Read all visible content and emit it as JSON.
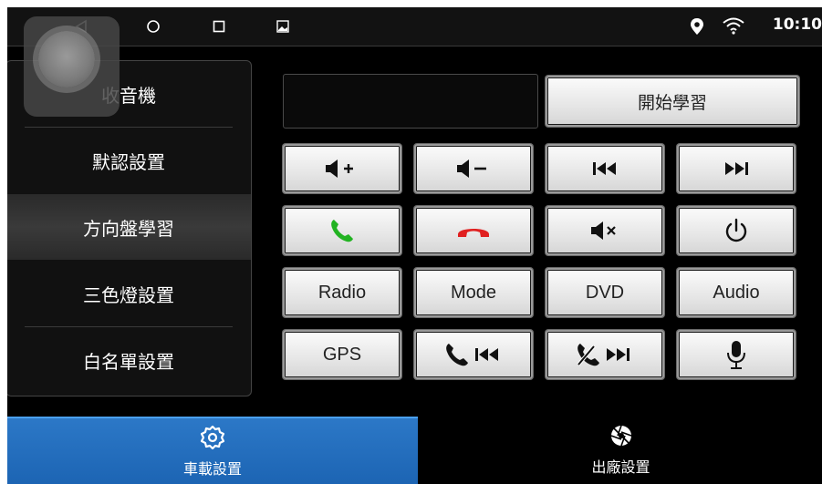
{
  "statusbar": {
    "time": "10:10",
    "icons": [
      "back-icon",
      "home-icon",
      "recents-icon",
      "gallery-icon",
      "location-icon",
      "wifi-icon"
    ]
  },
  "menu": {
    "items": [
      {
        "label": "收音機",
        "active": false
      },
      {
        "label": "默認設置",
        "active": false
      },
      {
        "label": "方向盤學習",
        "active": true
      },
      {
        "label": "三色燈設置",
        "active": false
      },
      {
        "label": "白名單設置",
        "active": false
      }
    ]
  },
  "learn_button": "開始學習",
  "buttons": {
    "row1": [
      "volume-up-icon",
      "volume-down-icon",
      "previous-track-icon",
      "next-track-icon"
    ],
    "row2": [
      "call-answer-icon",
      "call-hangup-icon",
      "mute-icon",
      "power-icon"
    ],
    "row3": [
      "Radio",
      "Mode",
      "DVD",
      "Audio"
    ],
    "row4": [
      "GPS",
      "call-previous-icon",
      "hangup-next-icon",
      "microphone-icon"
    ]
  },
  "tabs": [
    {
      "label": "車載設置",
      "icon": "gear-icon",
      "active": true
    },
    {
      "label": "出廠設置",
      "icon": "aperture-icon",
      "active": false
    }
  ],
  "colors": {
    "accent_tab": "#2270bf",
    "call_green": "#22b322",
    "call_red": "#e02020"
  }
}
